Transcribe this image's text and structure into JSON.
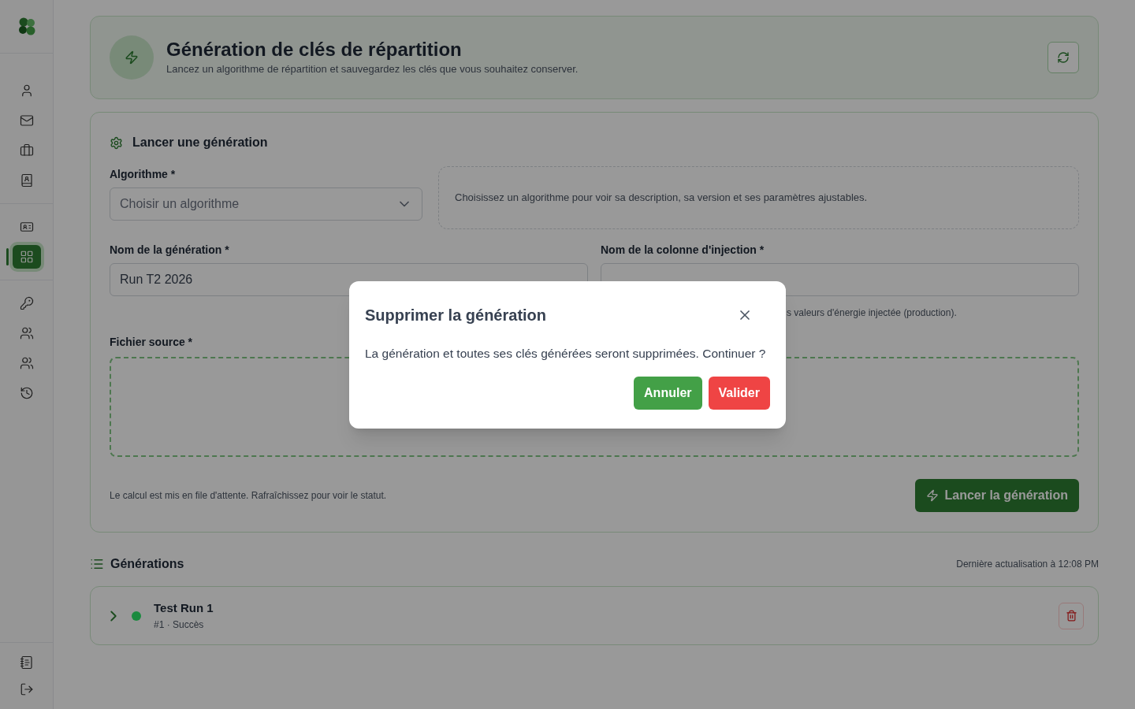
{
  "sidebar": {
    "groups": [
      [
        {
          "selected": false
        },
        {
          "selected": false
        },
        {
          "selected": false
        },
        {
          "selected": false
        }
      ],
      [
        {
          "selected": false
        },
        {
          "selected": true
        }
      ],
      [
        {
          "selected": false
        },
        {
          "selected": false
        },
        {
          "selected": false
        },
        {
          "selected": false
        }
      ]
    ],
    "footer": [
      {
        "selected": false
      },
      {
        "selected": false
      }
    ]
  },
  "header": {
    "title": "Génération de clés de répartition",
    "subtitle": "Lancez un algorithme de répartition et sauvegardez les clés que vous souhaitez conserver."
  },
  "form": {
    "title": "Lancer une génération",
    "algorithm": {
      "label": "Algorithme *",
      "placeholder": "Choisir un algorithme"
    },
    "algorithm_info": "Choisissez un algorithme pour voir sa description, sa version et ses paramètres ajustables.",
    "name": {
      "label": "Nom de la génération *",
      "value": "Run T2 2026"
    },
    "injection": {
      "label": "Nom de la colonne d'injection *",
      "hint": "s valeurs d'énergie injectée (production)."
    },
    "source": {
      "label": "Fichier source *"
    },
    "note": "Le calcul est mis en file d'attente. Rafraîchissez pour voir le statut.",
    "submit": "Lancer la génération"
  },
  "generations": {
    "title": "Générations",
    "updated": "Dernière actualisation à 12:08 PM",
    "rows": [
      {
        "name": "Test Run 1",
        "meta": "#1 · Succès",
        "color": "#1b8a3f",
        "expanded": false
      }
    ]
  },
  "dialog": {
    "title": "Supprimer la génération",
    "message": "La génération et toutes ses clés générées seront supprimées. Continuer ?",
    "buttons": [
      {
        "label": "Annuler",
        "kind": "confirm-cancel"
      },
      {
        "label": "Valider",
        "kind": "danger"
      }
    ]
  }
}
